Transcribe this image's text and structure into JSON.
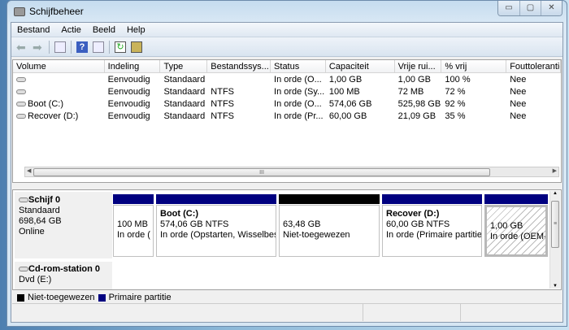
{
  "window": {
    "title": "Schijfbeheer",
    "minimize": "▭",
    "maximize": "▢",
    "close": "✕"
  },
  "menu": [
    "Bestand",
    "Actie",
    "Beeld",
    "Help"
  ],
  "toolbar": [
    "back-icon",
    "forward-icon",
    "console-tree-icon",
    "help-icon",
    "action-pane-icon",
    "refresh-icon",
    "properties-icon"
  ],
  "columns": [
    "Volume",
    "Indeling",
    "Type",
    "Bestandssys...",
    "Status",
    "Capaciteit",
    "Vrije rui...",
    "% vrij",
    "Fouttolerantie"
  ],
  "rows": [
    [
      "",
      "Eenvoudig",
      "Standaard",
      "",
      "In orde (O...",
      "1,00 GB",
      "1,00 GB",
      "100 %",
      "Nee"
    ],
    [
      "",
      "Eenvoudig",
      "Standaard",
      "NTFS",
      "In orde (Sy...",
      "100 MB",
      "72 MB",
      "72 %",
      "Nee"
    ],
    [
      "Boot (C:)",
      "Eenvoudig",
      "Standaard",
      "NTFS",
      "In orde (O...",
      "574,06 GB",
      "525,98 GB",
      "92 %",
      "Nee"
    ],
    [
      "Recover (D:)",
      "Eenvoudig",
      "Standaard",
      "NTFS",
      "In orde (Pr...",
      "60,00 GB",
      "21,09 GB",
      "35 %",
      "Nee"
    ]
  ],
  "disk0": {
    "name": "Schijf 0",
    "type": "Standaard",
    "size": "698,64 GB",
    "state": "Online",
    "partitions": [
      {
        "title": "",
        "size": "100 MB",
        "status": "In orde (",
        "color": "#000080"
      },
      {
        "title": "Boot  (C:)",
        "size": "574,06 GB NTFS",
        "status": "In orde (Opstarten, Wisselbest",
        "color": "#000080"
      },
      {
        "title": "",
        "size": "63,48 GB",
        "status": "Niet-toegewezen",
        "color": "#000000"
      },
      {
        "title": "Recover  (D:)",
        "size": "60,00 GB NTFS",
        "status": "In orde (Primaire partitie",
        "color": "#000080"
      },
      {
        "title": "",
        "size": "1,00 GB",
        "status": "In orde (OEM-",
        "color": "#000080"
      }
    ]
  },
  "cdrom": {
    "name": "Cd-rom-station 0",
    "type": "Dvd (E:)"
  },
  "legend": [
    {
      "label": "Niet-toegewezen",
      "color": "#000000"
    },
    {
      "label": "Primaire partitie",
      "color": "#000080"
    }
  ],
  "scroll_grip": "III"
}
